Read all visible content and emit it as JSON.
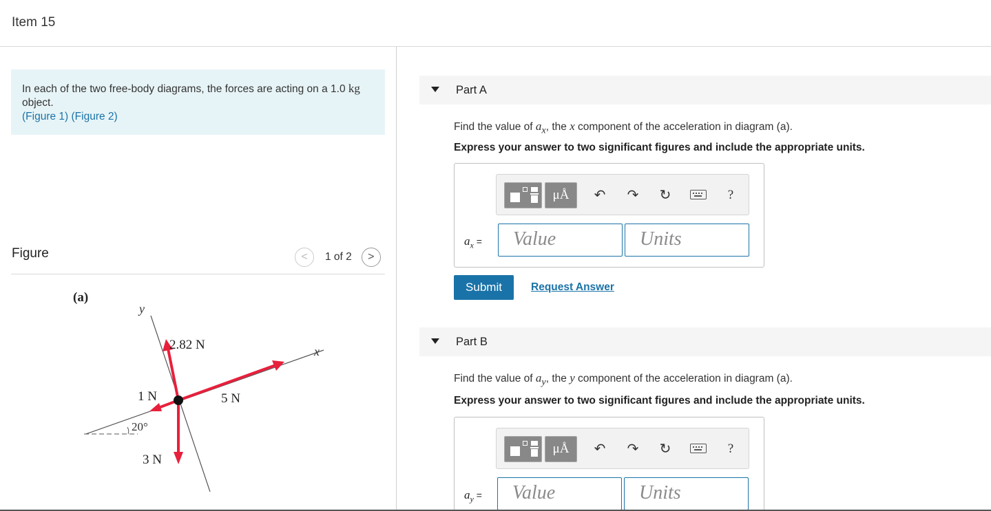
{
  "item": {
    "title": "Item 15"
  },
  "intro": {
    "text_pre": "In each of the two free-body diagrams, the forces are acting on a 1.0 ",
    "unit": "kg",
    "text_post": " object.",
    "links": [
      "(Figure 1)",
      "(Figure 2)"
    ]
  },
  "figure": {
    "title": "Figure",
    "pager": {
      "prev": "<",
      "count": "1 of 2",
      "next": ">"
    },
    "diagram": {
      "panel_label": "(a)",
      "axis_y": "y",
      "axis_x": "x",
      "forces": [
        "2.82 N",
        "5 N",
        "1 N",
        "3 N"
      ],
      "angle": "20°",
      "force_color": "#e8203c"
    }
  },
  "partA": {
    "label": "Part A",
    "q_pre": "Find the value of ",
    "q_var": "a",
    "q_sub": "x",
    "q_mid": ", the ",
    "q_comp": "x",
    "q_post": " component of the acceleration in diagram (a).",
    "instruction": "Express your answer to two significant figures and include the appropriate units.",
    "var": "a",
    "var_sub": "x",
    "eq": " =",
    "value_placeholder": "Value",
    "units_placeholder": "Units",
    "units_button": "μÅ",
    "help": "?",
    "submit": "Submit",
    "request": "Request Answer"
  },
  "partB": {
    "label": "Part B",
    "q_pre": "Find the value of ",
    "q_var": "a",
    "q_sub": "y",
    "q_mid": ", the ",
    "q_comp": "y",
    "q_post": " component of the acceleration in diagram (a).",
    "instruction": "Express your answer to two significant figures and include the appropriate units.",
    "var": "a",
    "var_sub": "y",
    "eq": " =",
    "value_placeholder": "Value",
    "units_placeholder": "Units",
    "units_button": "μÅ",
    "help": "?"
  },
  "colors": {
    "link": "#1a73a8",
    "intro_bg": "#e7f4f7",
    "submit_bg": "#1a73a8"
  }
}
